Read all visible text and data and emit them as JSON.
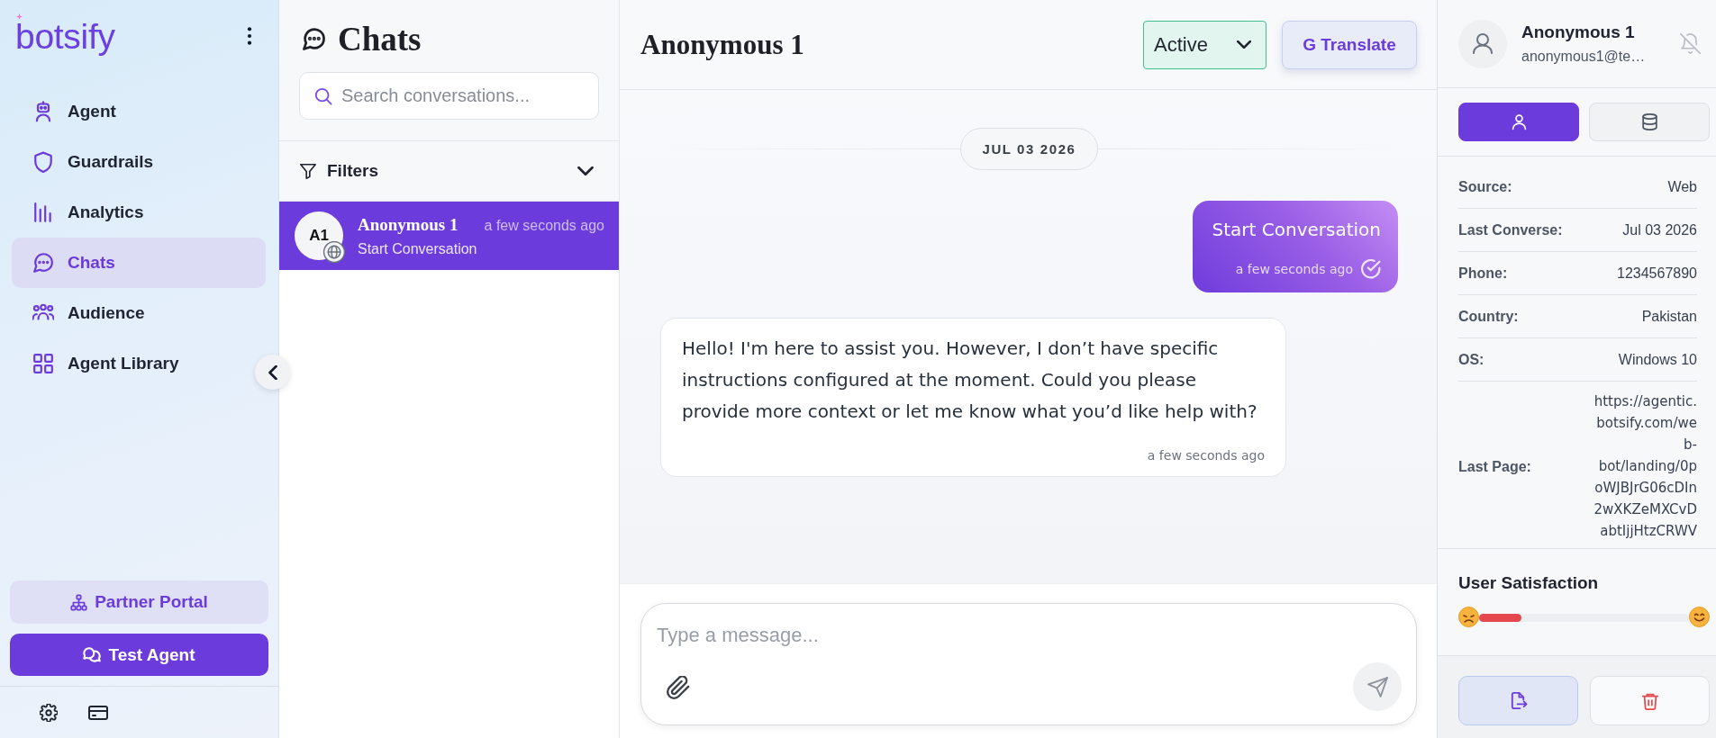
{
  "sidebar": {
    "logo": "botsify",
    "nav": [
      {
        "label": "Agent",
        "selected": false
      },
      {
        "label": "Guardrails",
        "selected": false
      },
      {
        "label": "Analytics",
        "selected": false
      },
      {
        "label": "Chats",
        "selected": true
      },
      {
        "label": "Audience",
        "selected": false
      },
      {
        "label": "Agent Library",
        "selected": false
      }
    ],
    "partner_portal_button": "Partner Portal",
    "test_agent_button": "Test Agent"
  },
  "chat_list": {
    "title": "Chats",
    "search": {
      "placeholder": "Search conversations..."
    },
    "filters": "Filters",
    "conversations": [
      {
        "initials": "A1",
        "name": "Anonymous 1",
        "time": "a few seconds ago",
        "preview": "Start Conversation",
        "selected": true
      }
    ]
  },
  "conversation": {
    "title": "Anonymous 1",
    "status": "Active",
    "translate_button": "G Translate",
    "date": "JUL 03 2026",
    "messages": [
      {
        "kind": "outgoing",
        "text": "Start Conversation",
        "time": "a few seconds ago"
      },
      {
        "kind": "incoming",
        "text": "Hello! I'm here to assist you. However, I don’t have specific instructions configured at the moment. Could you please provide more context or let me know what you’d like help with?",
        "time": "a few seconds ago"
      }
    ],
    "composer": {
      "placeholder": "Type a message..."
    }
  },
  "contact": {
    "name": "Anonymous 1",
    "email": "anonymous1@te…",
    "tabs": [
      {
        "selected": true
      },
      {
        "selected": false
      }
    ],
    "details": [
      {
        "label": "Source:",
        "value": "Web"
      },
      {
        "label": "Last Converse:",
        "value": "Jul 03 2026"
      },
      {
        "label": "Phone:",
        "value": "1234567890"
      },
      {
        "label": "Country:",
        "value": "Pakistan"
      },
      {
        "label": "OS:",
        "value": "Windows 10"
      },
      {
        "label": "Last Page:",
        "value": "https://agentic.botsify.com/web-bot/landing/0poWJBJrG06cDIn2wXKZeMXCvDabtIjjHtzCRWV"
      }
    ],
    "satisfaction": {
      "title": "User Satisfaction",
      "level": 0.2
    }
  }
}
